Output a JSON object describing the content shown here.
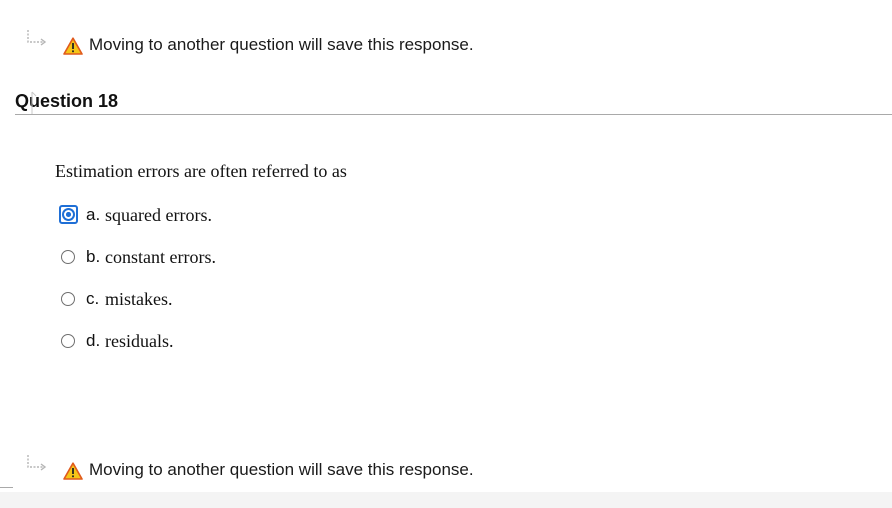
{
  "notice_top": {
    "arrow_icon": "return-arrow-icon",
    "warning_icon": "warning-icon",
    "text": "Moving to another question will save this response."
  },
  "question": {
    "title": "Question 18",
    "prompt": "Estimation errors are often referred to as",
    "selected_option": "a",
    "options": [
      {
        "letter": "a.",
        "text": "squared errors."
      },
      {
        "letter": "b.",
        "text": "constant errors."
      },
      {
        "letter": "c.",
        "text": "mistakes."
      },
      {
        "letter": "d.",
        "text": "residuals."
      }
    ]
  },
  "notice_bottom": {
    "arrow_icon": "return-arrow-icon",
    "warning_icon": "warning-icon",
    "text": "Moving to another question will save this response."
  },
  "colors": {
    "selected_blue": "#1f6fd6",
    "warning_yellow": "#f5c518",
    "warning_orange": "#e05a1c",
    "rule_gray": "#a9a9a9"
  }
}
